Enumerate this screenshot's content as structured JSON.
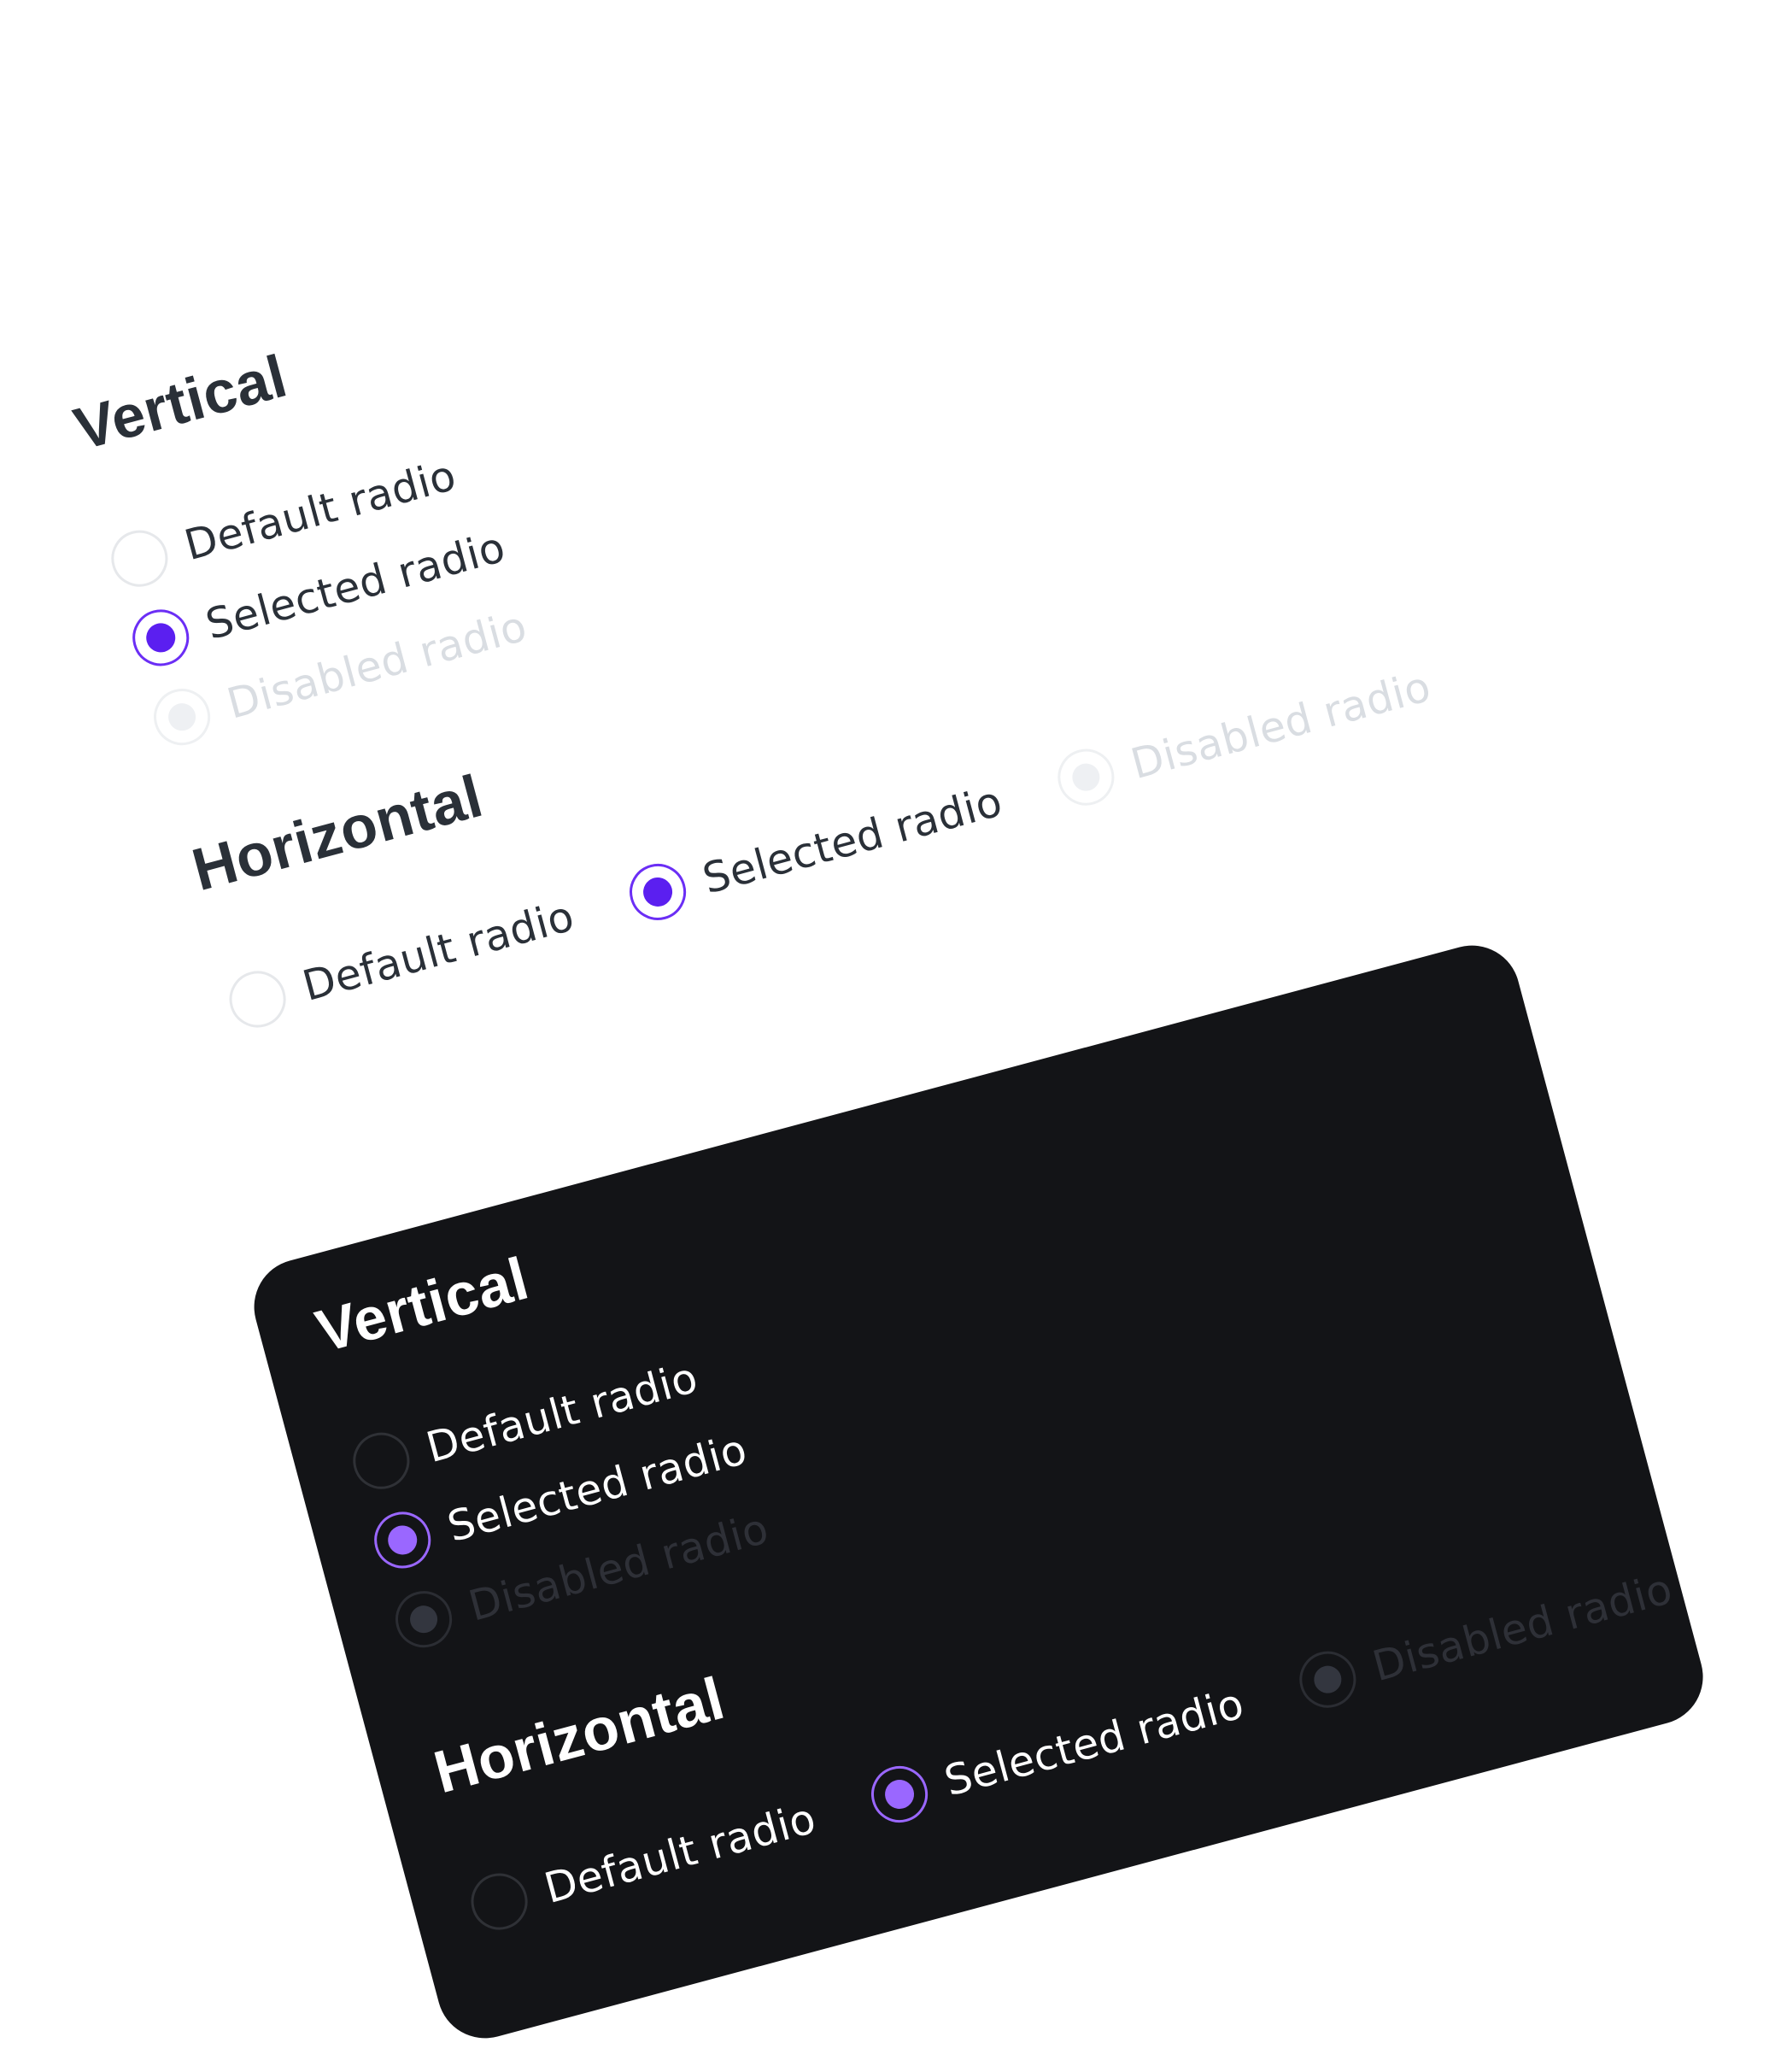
{
  "light": {
    "vertical": {
      "title": "Vertical",
      "radios": [
        {
          "label": "Default radio",
          "state": "default"
        },
        {
          "label": "Selected radio",
          "state": "selected"
        },
        {
          "label": "Disabled radio",
          "state": "disabled"
        }
      ]
    },
    "horizontal": {
      "title": "Horizontal",
      "radios": [
        {
          "label": "Default radio",
          "state": "default"
        },
        {
          "label": "Selected radio",
          "state": "selected"
        },
        {
          "label": "Disabled radio",
          "state": "disabled"
        }
      ]
    }
  },
  "dark": {
    "vertical": {
      "title": "Vertical",
      "radios": [
        {
          "label": "Default radio",
          "state": "default"
        },
        {
          "label": "Selected radio",
          "state": "selected"
        },
        {
          "label": "Disabled radio",
          "state": "disabled"
        }
      ]
    },
    "horizontal": {
      "title": "Horizontal",
      "radios": [
        {
          "label": "Default radio",
          "state": "default"
        },
        {
          "label": "Selected radio",
          "state": "selected"
        },
        {
          "label": "Disabled radio",
          "state": "disabled"
        }
      ]
    }
  },
  "colors": {
    "page_background": "#ffffff",
    "dark_card_background": "#131417",
    "light_accent": "#5b1ff0",
    "dark_accent": "#9a67ff",
    "light_text": "#2a3038",
    "dark_text": "#ffffff"
  }
}
